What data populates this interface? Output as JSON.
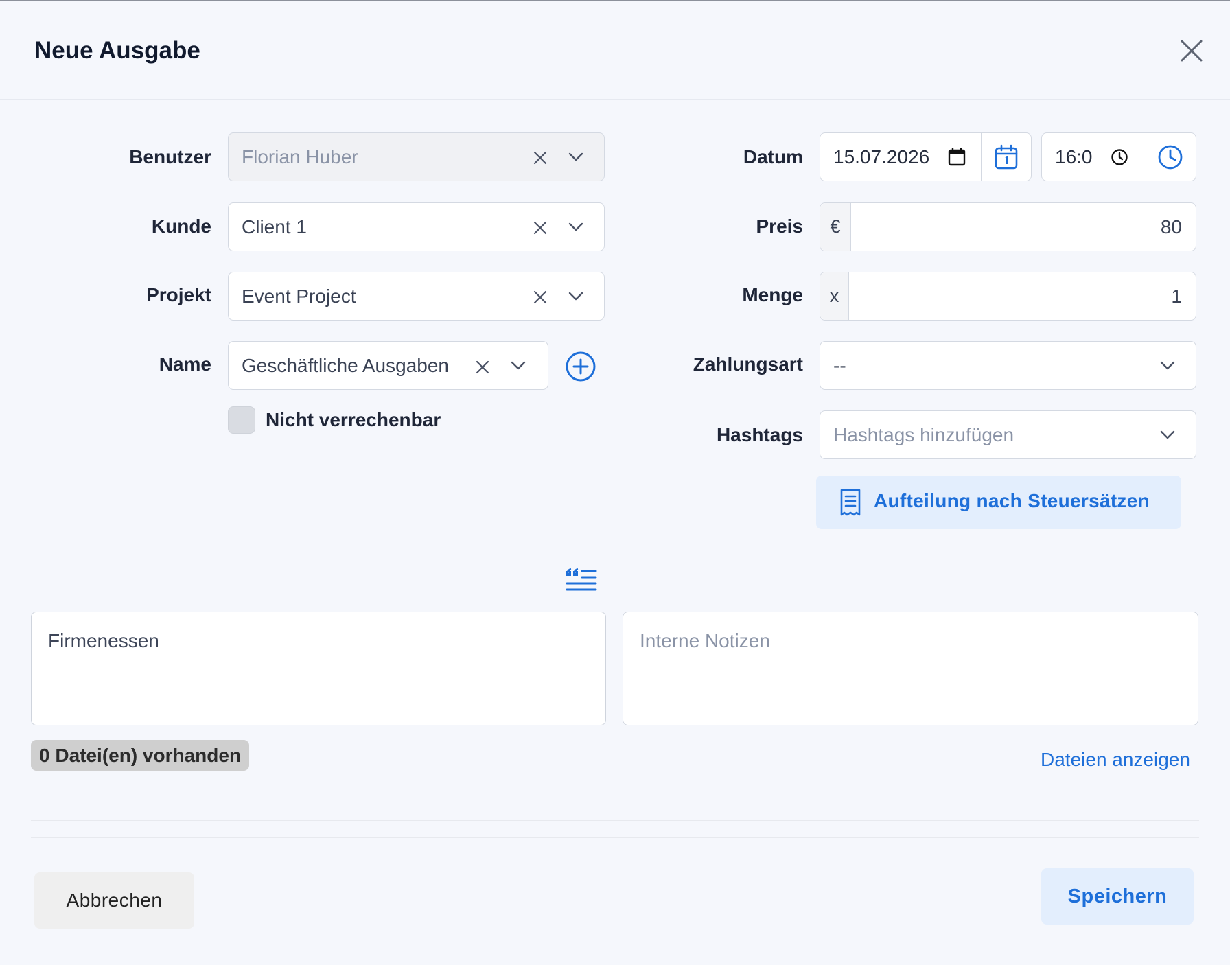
{
  "dialog": {
    "title": "Neue Ausgabe"
  },
  "form": {
    "user": {
      "label": "Benutzer",
      "value": "Florian Huber"
    },
    "client": {
      "label": "Kunde",
      "value": "Client 1"
    },
    "project": {
      "label": "Projekt",
      "value": "Event Project"
    },
    "name": {
      "label": "Name",
      "value": "Geschäftliche Ausgaben"
    },
    "not_billable": {
      "label": "Nicht verrechenbar",
      "checked": false
    },
    "date": {
      "label": "Datum",
      "value": "15.07.2026"
    },
    "time": {
      "value": "16:0"
    },
    "price": {
      "label": "Preis",
      "currency": "€",
      "value": "80"
    },
    "quantity": {
      "label": "Menge",
      "prefix": "x",
      "value": "1"
    },
    "payment_method": {
      "label": "Zahlungsart",
      "value": "--"
    },
    "hashtags": {
      "label": "Hashtags",
      "placeholder": "Hashtags hinzufügen"
    },
    "tax_split_button": "Aufteilung nach Steuersätzen",
    "description": {
      "value": "Firmenessen"
    },
    "internal_notes": {
      "placeholder": "Interne Notizen"
    }
  },
  "files": {
    "count_badge": "0 Datei(en) vorhanden",
    "show_link": "Dateien anzeigen"
  },
  "footer": {
    "cancel_label": "Abbrechen",
    "save_label": "Speichern"
  },
  "colors": {
    "accent": "#1e6fd9",
    "background": "#f5f7fc",
    "accent_light": "#e3eefd"
  }
}
